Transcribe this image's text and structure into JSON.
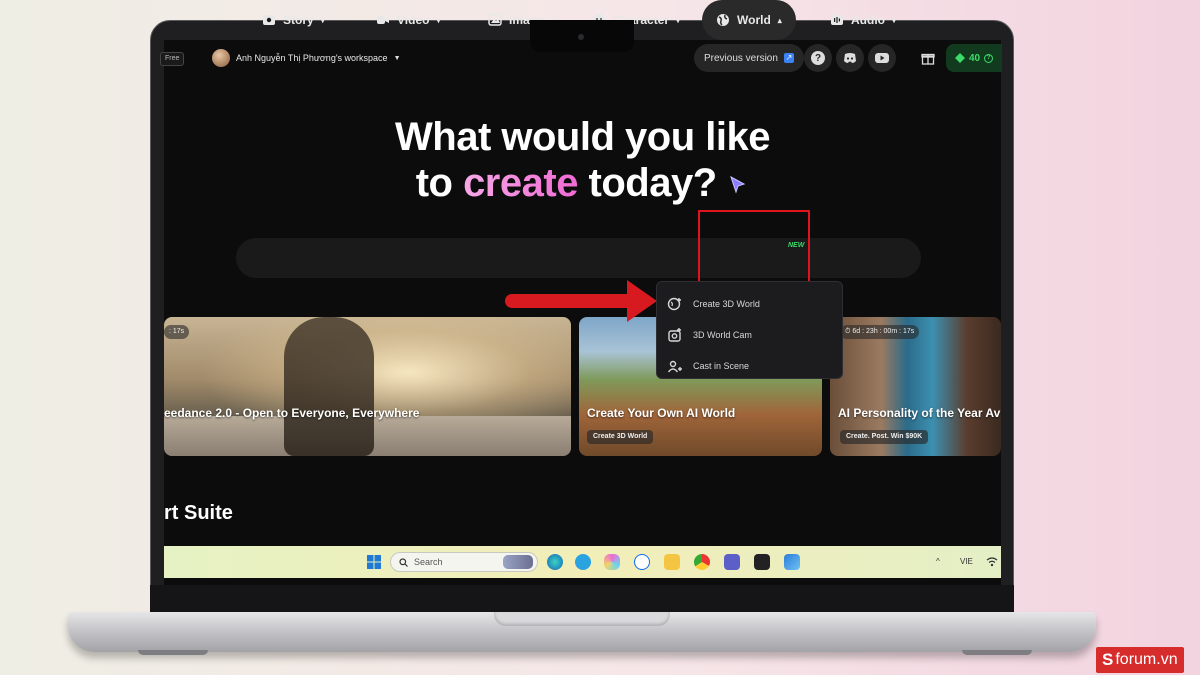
{
  "topbar": {
    "plan_badge": "Free",
    "workspace_name": "Anh Nguyễn Thị Phương's workspace",
    "previous_version": "Previous version",
    "credits": "40"
  },
  "hero": {
    "line1": "What would you like",
    "line2_pre": "to ",
    "line2_accent": "create",
    "line2_post": " today?"
  },
  "nav": {
    "items": [
      {
        "label": "Story",
        "icon": "story-icon"
      },
      {
        "label": "Video",
        "icon": "video-icon"
      },
      {
        "label": "Image",
        "icon": "image-icon"
      },
      {
        "label": "Character",
        "icon": "character-icon"
      },
      {
        "label": "World",
        "icon": "globe-icon",
        "badge": "NEW"
      },
      {
        "label": "Audio",
        "icon": "audio-icon"
      }
    ]
  },
  "world_menu": {
    "items": [
      {
        "label": "Create 3D World",
        "icon": "globe-plus-icon"
      },
      {
        "label": "3D World Cam",
        "icon": "camera-icon"
      },
      {
        "label": "Cast in Scene",
        "icon": "people-plus-icon"
      }
    ]
  },
  "cards": [
    {
      "title": "eedance 2.0 - Open to Everyone, Everywhere",
      "timer": ": 17s"
    },
    {
      "title": "Create Your Own AI World",
      "chip": "Create 3D World"
    },
    {
      "title": "AI Personality of the Year Av",
      "chip": "Create. Post. Win $90K",
      "timer": "6d : 23h : 00m : 17s"
    }
  ],
  "section_title": "rt Suite",
  "taskbar": {
    "search_placeholder": "Search",
    "language": "VIE"
  },
  "watermark": {
    "s": "S",
    "text": "forum.vn"
  },
  "colors": {
    "accent_pink": "#f06ad4",
    "credits_green": "#3ddc6a",
    "highlight_red": "#e0141c"
  }
}
